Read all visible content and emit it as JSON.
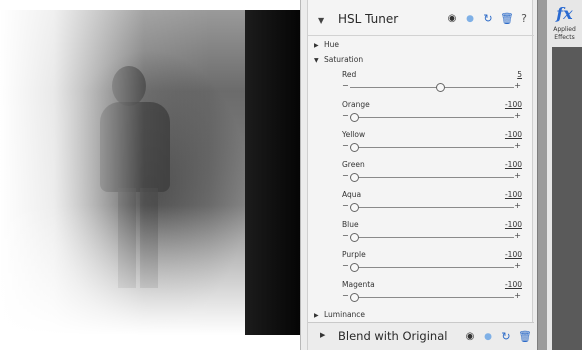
{
  "panel": {
    "title": "HSL Tuner",
    "sections": {
      "hue": "Hue",
      "saturation": "Saturation",
      "luminance": "Luminance"
    },
    "sliders": [
      {
        "label": "Red",
        "value": "5",
        "fraction": 0.55
      },
      {
        "label": "Orange",
        "value": "-100",
        "fraction": 0.0
      },
      {
        "label": "Yellow",
        "value": "-100",
        "fraction": 0.0
      },
      {
        "label": "Green",
        "value": "-100",
        "fraction": 0.0
      },
      {
        "label": "Aqua",
        "value": "-100",
        "fraction": 0.0
      },
      {
        "label": "Blue",
        "value": "-100",
        "fraction": 0.0
      },
      {
        "label": "Purple",
        "value": "-100",
        "fraction": 0.0
      },
      {
        "label": "Magenta",
        "value": "-100",
        "fraction": 0.0
      }
    ],
    "minus": "−",
    "plus": "+"
  },
  "footer": {
    "title": "Blend with Original"
  },
  "rail": {
    "fx": "fx",
    "label_line1": "Applied",
    "label_line2": "Effects"
  },
  "icons": [
    "eye-icon",
    "droplet-icon",
    "reset-icon",
    "trash-icon",
    "help-icon",
    "triangle-icon"
  ],
  "colors": {
    "accent": "#2b6ac8",
    "panel_bg": "#f4f4f4"
  }
}
